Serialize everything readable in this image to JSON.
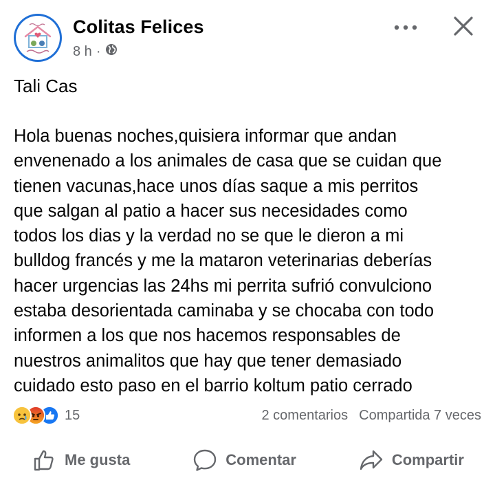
{
  "header": {
    "page_name": "Colitas Felices",
    "time": "8 h",
    "separator": "·",
    "privacy_icon": "globe-icon"
  },
  "post": {
    "author_line": "Tali Cas",
    "body_lines": [
      "Hola buenas noches,quisiera informar que andan",
      "envenenado a los animales de casa que se cuidan que",
      "tienen vacunas,hace unos días saque a mis perritos",
      "que salgan al patio a hacer sus necesidades como",
      "todos los dias y la verdad no se que le dieron a mi",
      "bulldog francés y me la mataron veterinarias deberías",
      "hacer urgencias las 24hs  mi perrita sufrió convulciono",
      "estaba desorientada caminaba y se chocaba con todo",
      "informen a los que nos hacemos responsables de",
      "nuestros animalitos que hay que tener demasiado",
      "cuidado esto paso en el barrio koltum patio cerrado"
    ]
  },
  "stats": {
    "reaction_icons": [
      "sad-reaction-icon",
      "angry-reaction-icon",
      "like-reaction-icon"
    ],
    "reaction_count": "15",
    "comments": "2 comentarios",
    "shares": "Compartida 7 veces"
  },
  "actions": {
    "like_label": "Me gusta",
    "comment_label": "Comentar",
    "share_label": "Compartir"
  },
  "colors": {
    "text_primary": "#050505",
    "text_secondary": "#65676b",
    "like_blue": "#1877f2",
    "angry_red": "#e9710f",
    "avatar_ring": "#1f6fd6"
  }
}
